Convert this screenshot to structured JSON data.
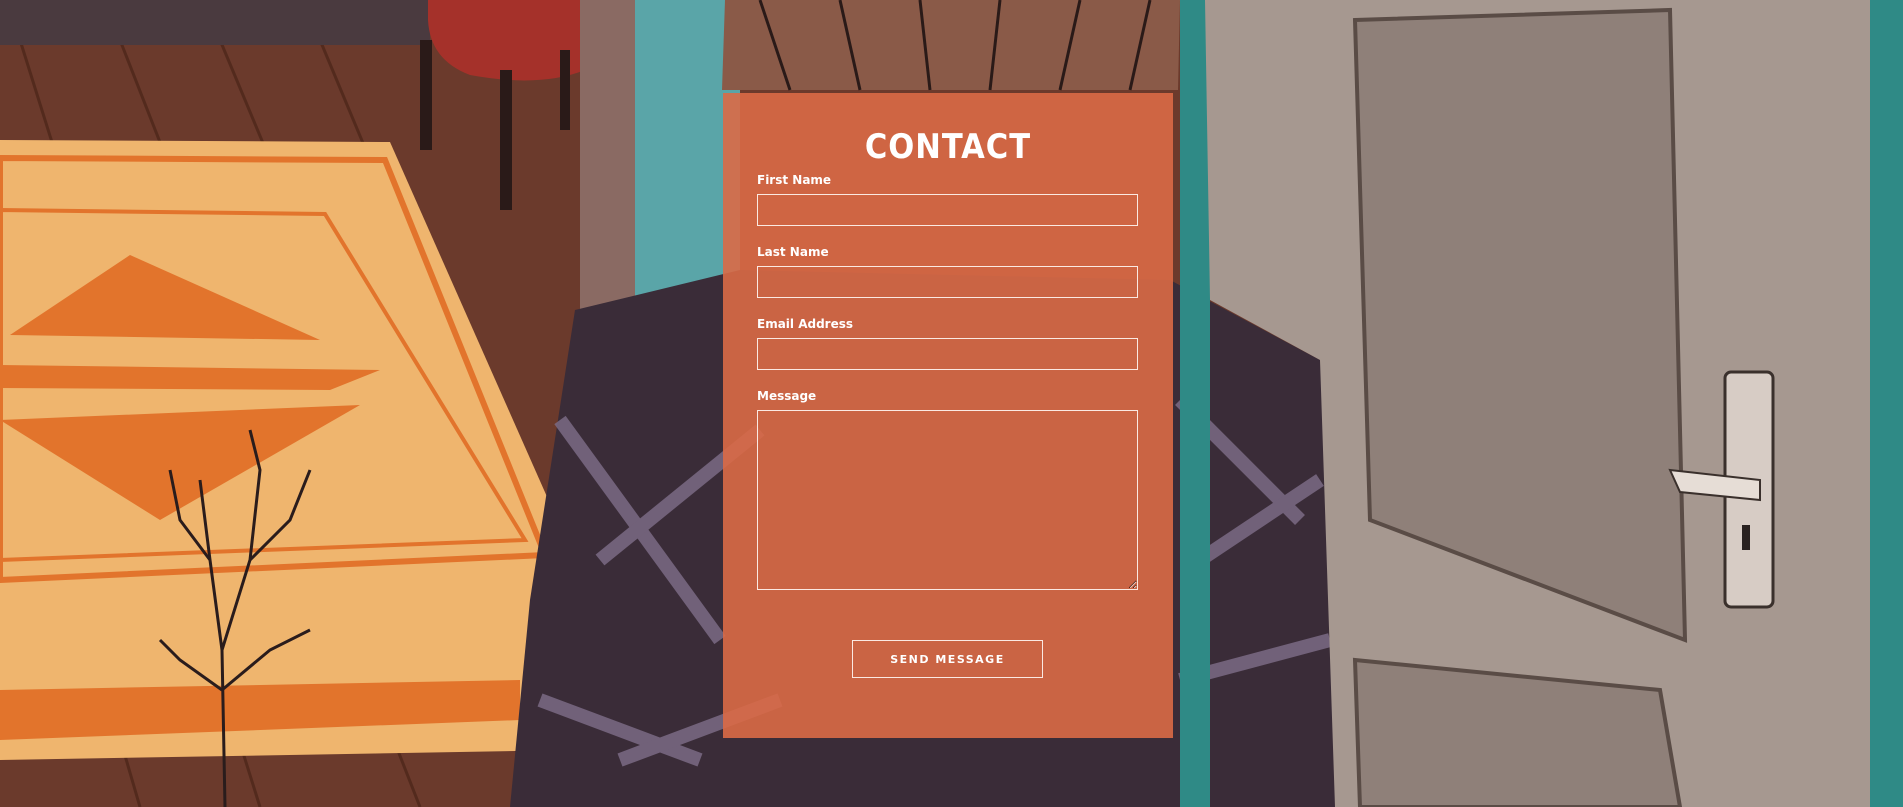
{
  "contact": {
    "title": "CONTACT",
    "fields": [
      {
        "label": "First Name",
        "value": ""
      },
      {
        "label": "Last Name",
        "value": ""
      },
      {
        "label": "Email Address",
        "value": ""
      },
      {
        "label": "Message",
        "value": ""
      }
    ],
    "submit_label": "SEND MESSAGE"
  },
  "colors": {
    "panel": "#da6a46",
    "field_border": "#fbe9e2",
    "text": "#ffffff"
  }
}
